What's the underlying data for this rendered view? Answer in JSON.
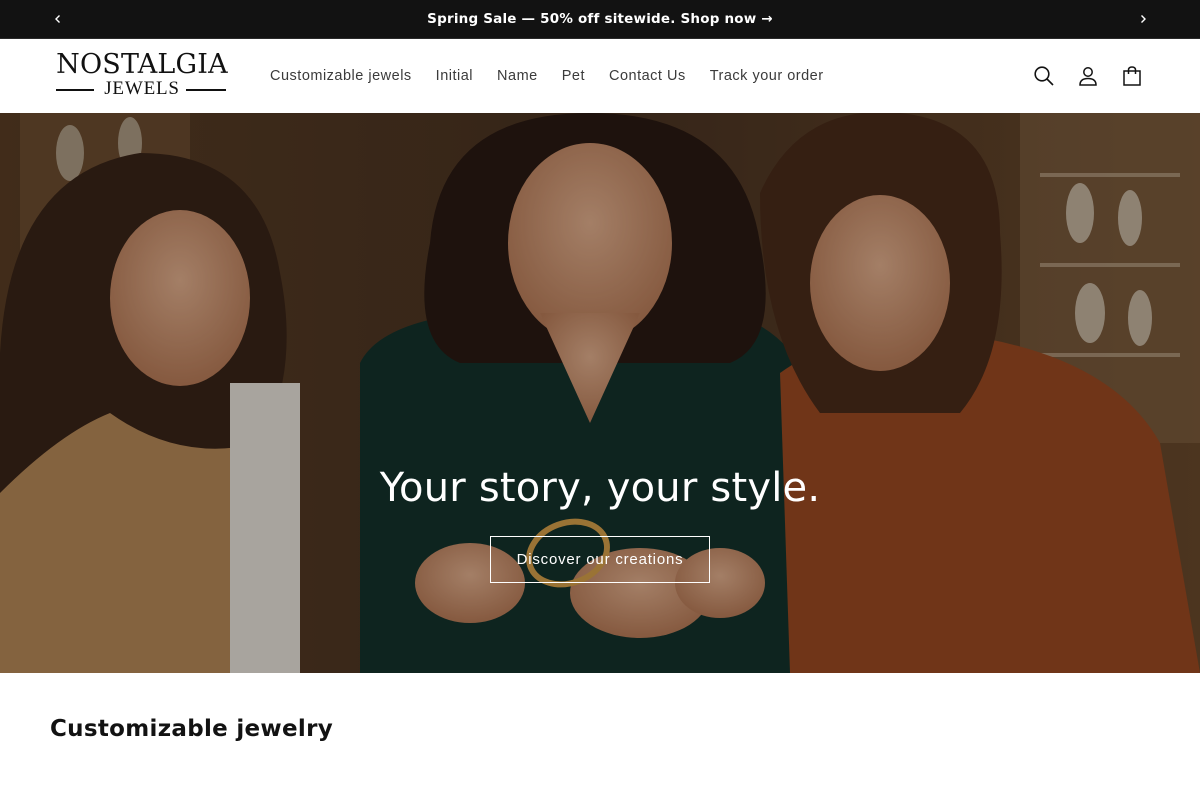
{
  "announcement": {
    "text": "Spring Sale — 50% off sitewide. Shop now →",
    "prev_icon": "chevron-left-icon",
    "next_icon": "chevron-right-icon"
  },
  "header": {
    "logo": {
      "line1": "NOSTALGIA",
      "line2": "JEWELS"
    },
    "nav": [
      {
        "label": "Customizable jewels"
      },
      {
        "label": "Initial"
      },
      {
        "label": "Name"
      },
      {
        "label": "Pet"
      },
      {
        "label": "Contact Us"
      },
      {
        "label": "Track your order"
      }
    ],
    "icons": [
      "search-icon",
      "account-icon",
      "cart-icon"
    ]
  },
  "hero": {
    "title": "Your story, your style.",
    "button_label": "Discover our creations"
  },
  "section": {
    "title": "Customizable jewelry"
  },
  "colors": {
    "announcement_bg": "#121212",
    "text": "#121212",
    "nav_text": "#3b3b3b",
    "hero_overlay": "rgba(0,0,0,0.28)"
  }
}
